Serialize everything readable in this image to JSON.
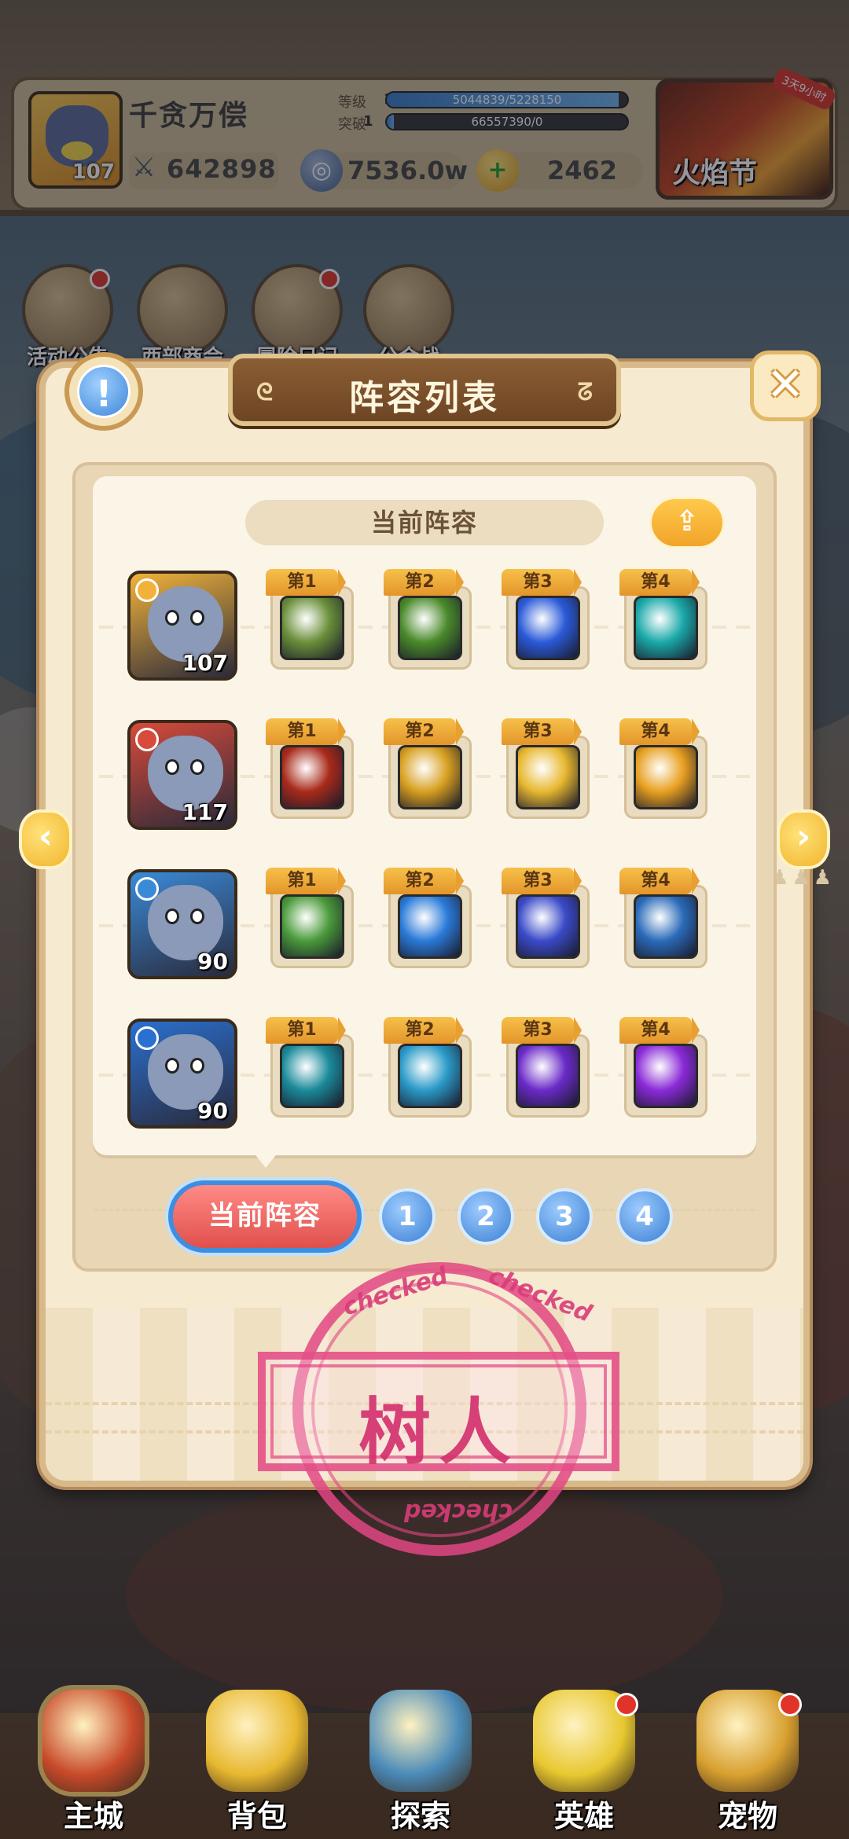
{
  "player": {
    "name": "千贪万偿",
    "level": "107",
    "power": "642898",
    "stats": {
      "level_label": "等级",
      "level_value": "107",
      "level_exp": "5044839/5228150",
      "level_progress": 0.965,
      "break_label": "突破",
      "break_value": "1",
      "break_exp": "66557390/0",
      "break_progress": 0.03
    },
    "currency_1": "7536.0w",
    "currency_2": "2462"
  },
  "event": {
    "title": "火焰节",
    "timer": "3天9小时"
  },
  "shortcuts": [
    {
      "label": "活动公告",
      "icon": "notice-board-icon",
      "dot": true
    },
    {
      "label": "西部商会",
      "icon": "merchant-icon",
      "dot": false
    },
    {
      "label": "冒险日记",
      "icon": "diary-icon",
      "dot": true
    },
    {
      "label": "公会战",
      "icon": "guild-shield-icon",
      "dot": false
    }
  ],
  "modal": {
    "title": "阵容列表",
    "section_title": "当前阵容",
    "info_icon": "info-icon",
    "close_icon": "close-icon",
    "share_icon": "share-icon"
  },
  "lineup": [
    {
      "hero_level": "107",
      "hero_color": "#f2b23a",
      "skills": [
        {
          "tag": "第1",
          "color": "#6a8f3a"
        },
        {
          "tag": "第2",
          "color": "#4a8a2a"
        },
        {
          "tag": "第3",
          "color": "#2a5ad8"
        },
        {
          "tag": "第4",
          "color": "#1aa8a8"
        }
      ]
    },
    {
      "hero_level": "117",
      "hero_color": "#d84a3a",
      "skills": [
        {
          "tag": "第1",
          "color": "#a82a1a"
        },
        {
          "tag": "第2",
          "color": "#d8a020"
        },
        {
          "tag": "第3",
          "color": "#e8b830"
        },
        {
          "tag": "第4",
          "color": "#e8a020"
        }
      ]
    },
    {
      "hero_level": "90",
      "hero_color": "#3a8ad8",
      "skills": [
        {
          "tag": "第1",
          "color": "#4a9a3a"
        },
        {
          "tag": "第2",
          "color": "#2a7ad8"
        },
        {
          "tag": "第3",
          "color": "#3a4ac8"
        },
        {
          "tag": "第4",
          "color": "#2a6ab8"
        }
      ]
    },
    {
      "hero_level": "90",
      "hero_color": "#2a70d0",
      "skills": [
        {
          "tag": "第1",
          "color": "#1a8a9a"
        },
        {
          "tag": "第2",
          "color": "#2a9ac8"
        },
        {
          "tag": "第3",
          "color": "#6a2ac8"
        },
        {
          "tag": "第4",
          "color": "#8a2ad8"
        }
      ]
    }
  ],
  "team_tabs": {
    "current": "当前阵容",
    "slots": [
      "1",
      "2",
      "3",
      "4"
    ]
  },
  "stamp": {
    "ring_text": "checked",
    "center_text": "树人"
  },
  "nav": [
    {
      "label": "主城",
      "icon": "castle-icon",
      "active": true,
      "dot": false
    },
    {
      "label": "背包",
      "icon": "backpack-icon",
      "active": false,
      "dot": false
    },
    {
      "label": "探索",
      "icon": "map-icon",
      "active": false,
      "dot": false
    },
    {
      "label": "英雄",
      "icon": "hero-icon",
      "active": false,
      "dot": true
    },
    {
      "label": "宠物",
      "icon": "pet-icon",
      "active": false,
      "dot": true
    }
  ]
}
